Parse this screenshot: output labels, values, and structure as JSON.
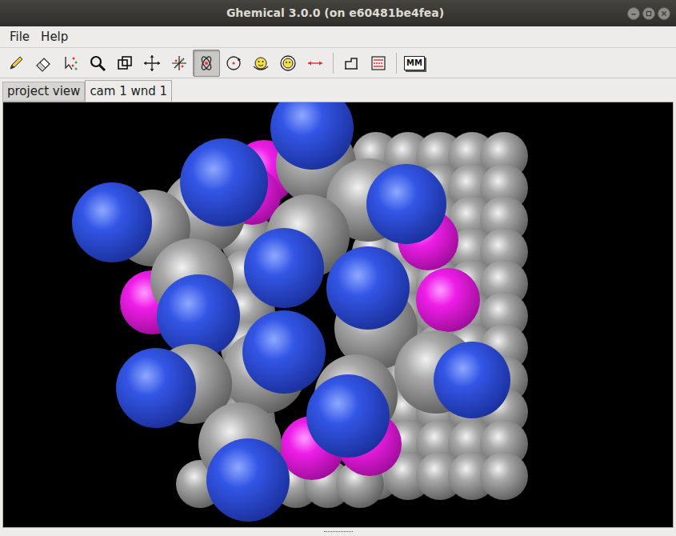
{
  "window": {
    "title": "Ghemical 3.0.0 (on e60481be4fea)"
  },
  "menu": [
    "File",
    "Help"
  ],
  "toolbar": {
    "groups": [
      [
        {
          "selected": false
        },
        {
          "selected": false
        },
        {
          "selected": false
        },
        {
          "selected": false
        },
        {
          "selected": false
        },
        {
          "selected": false
        },
        {
          "selected": false
        },
        {
          "selected": true
        },
        {
          "selected": false
        },
        {
          "selected": false
        },
        {
          "selected": false
        },
        {
          "selected": false
        }
      ],
      [
        {
          "selected": false
        },
        {
          "selected": false
        }
      ],
      [
        {
          "selected": false,
          "label": "MM"
        }
      ]
    ]
  },
  "tabs": [
    {
      "label": "project view",
      "selected": false
    },
    {
      "label": "cam 1 wnd 1",
      "selected": true
    }
  ]
}
